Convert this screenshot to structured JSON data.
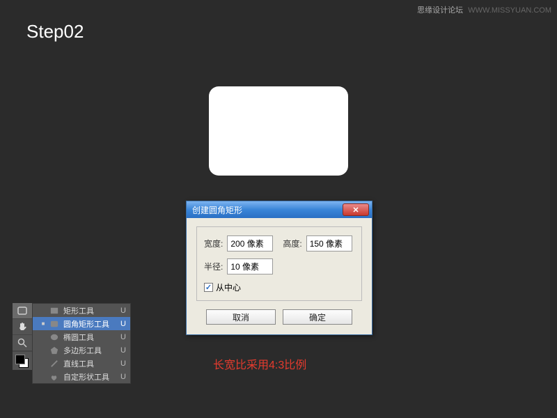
{
  "step_title": "Step02",
  "watermark": {
    "label": "思缘设计论坛",
    "url": "WWW.MISSYUAN.COM"
  },
  "dialog": {
    "title": "创建圆角矩形",
    "width_label": "宽度:",
    "width_value": "200 像素",
    "height_label": "高度:",
    "height_value": "150 像素",
    "radius_label": "半径:",
    "radius_value": "10 像素",
    "from_center_label": "从中心",
    "cancel": "取消",
    "ok": "确定"
  },
  "note": "长宽比采用4:3比例",
  "tools": [
    {
      "name": "矩形工具",
      "key": "U",
      "selected": false,
      "icon": "rect"
    },
    {
      "name": "圆角矩形工具",
      "key": "U",
      "selected": true,
      "icon": "rrect"
    },
    {
      "name": "椭圆工具",
      "key": "U",
      "selected": false,
      "icon": "ellipse"
    },
    {
      "name": "多边形工具",
      "key": "U",
      "selected": false,
      "icon": "poly"
    },
    {
      "name": "直线工具",
      "key": "U",
      "selected": false,
      "icon": "line"
    },
    {
      "name": "自定形状工具",
      "key": "U",
      "selected": false,
      "icon": "custom"
    }
  ]
}
